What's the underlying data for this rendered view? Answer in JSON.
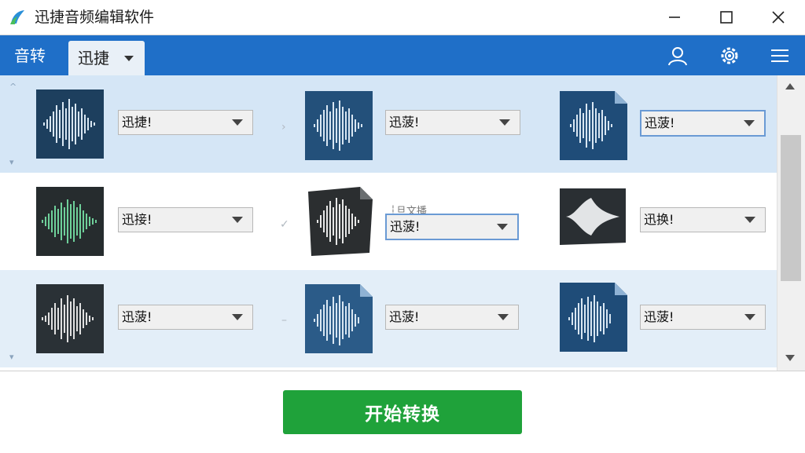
{
  "window": {
    "title": "迅捷音频编辑软件",
    "minimize_icon": "minimize-icon",
    "maximize_icon": "maximize-icon",
    "close_icon": "close-icon"
  },
  "toolbar": {
    "tabs": [
      {
        "label": "音转"
      },
      {
        "label": "迅捷"
      }
    ],
    "icons": [
      "user-icon",
      "gear-icon",
      "menu-icon"
    ],
    "accent": "#1f6fc8"
  },
  "rows": [
    {
      "items": [
        {
          "thumb": "audio-waveform-blue",
          "dropdown": "迅捷!"
        },
        {
          "thumb": "audio-waveform-blue",
          "dropdown": "迅菠!"
        },
        {
          "thumb": "audio-waveform-blue",
          "dropdown": "迅菠!"
        }
      ]
    },
    {
      "items": [
        {
          "thumb": "audio-waveform-green",
          "dropdown": "迅接!"
        },
        {
          "thumb": "audio-waveform-dark",
          "dropdown": "迅菠!",
          "caption": "┆旦文播"
        },
        {
          "thumb": "audio-waveform-dark",
          "dropdown": "迅换!"
        }
      ]
    },
    {
      "items": [
        {
          "thumb": "audio-waveform-dark",
          "dropdown": "迅菠!"
        },
        {
          "thumb": "audio-waveform-blue",
          "dropdown": "迅菠!"
        },
        {
          "thumb": "audio-waveform-blue",
          "dropdown": "迅菠!"
        }
      ]
    }
  ],
  "footer": {
    "start_label": "开始转换",
    "start_color": "#1fa23a"
  }
}
